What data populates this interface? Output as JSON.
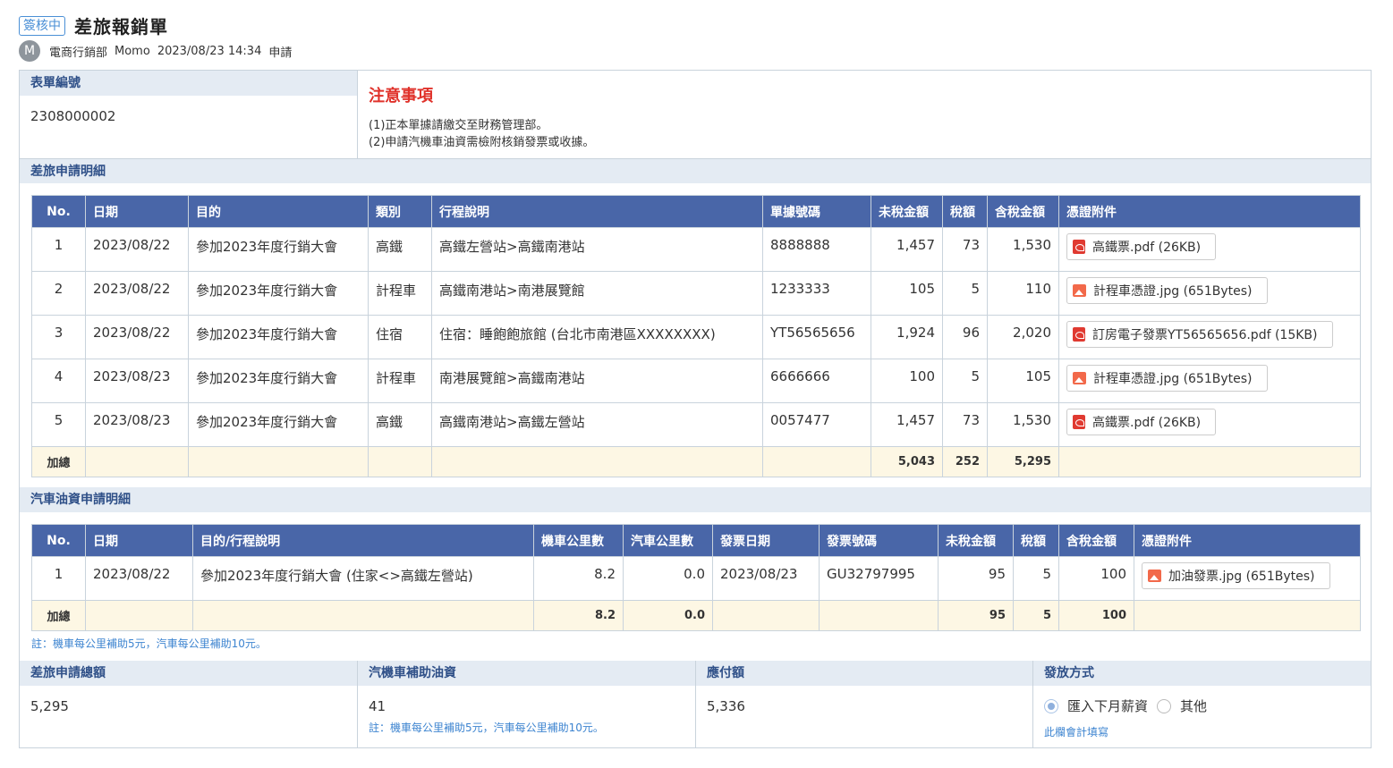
{
  "header": {
    "status_badge": "簽核中",
    "title": "差旅報銷單",
    "avatar_letter": "M",
    "department": "電商行銷部",
    "user": "Momo",
    "datetime": "2023/08/23 14:34",
    "action": "申請"
  },
  "form_no": {
    "label": "表單編號",
    "value": "2308000002"
  },
  "notice": {
    "title": "注意事項",
    "lines": [
      "(1)正本單據請繳交至財務管理部。",
      "(2)申請汽機車油資需檢附核銷發票或收據。"
    ]
  },
  "travel": {
    "section_label": "差旅申請明細",
    "headers": [
      "No.",
      "日期",
      "目的",
      "類別",
      "行程說明",
      "單據號碼",
      "未稅金額",
      "稅額",
      "含稅金額",
      "憑證附件"
    ],
    "rows": [
      [
        "1",
        "2023/08/22",
        "參加2023年度行銷大會",
        "高鐵",
        "高鐵左營站>高鐵南港站",
        "8888888",
        "1,457",
        "73",
        "1,530",
        "高鐵票.pdf (26KB)"
      ],
      [
        "2",
        "2023/08/22",
        "參加2023年度行銷大會",
        "計程車",
        "高鐵南港站>南港展覽館",
        "1233333",
        "105",
        "5",
        "110",
        "計程車憑證.jpg (651Bytes)"
      ],
      [
        "3",
        "2023/08/22",
        "參加2023年度行銷大會",
        "住宿",
        "住宿：睡飽飽旅館 (台北市南港區XXXXXXXX)",
        "YT56565656",
        "1,924",
        "96",
        "2,020",
        "訂房電子發票YT56565656.pdf (15KB)"
      ],
      [
        "4",
        "2023/08/23",
        "參加2023年度行銷大會",
        "計程車",
        "南港展覽館>高鐵南港站",
        "6666666",
        "100",
        "5",
        "105",
        "計程車憑證.jpg (651Bytes)"
      ],
      [
        "5",
        "2023/08/23",
        "參加2023年度行銷大會",
        "高鐵",
        "高鐵南港站>高鐵左營站",
        "0057477",
        "1,457",
        "73",
        "1,530",
        "高鐵票.pdf (26KB)"
      ]
    ],
    "attachment_types": [
      "pdf",
      "image",
      "pdf",
      "image",
      "pdf"
    ],
    "total": {
      "label": "加總",
      "pretax": "5,043",
      "tax": "252",
      "total": "5,295"
    }
  },
  "fuel": {
    "section_label": "汽車油資申請明細",
    "headers": [
      "No.",
      "日期",
      "目的/行程說明",
      "機車公里數",
      "汽車公里數",
      "發票日期",
      "發票號碼",
      "未稅金額",
      "稅額",
      "含稅金額",
      "憑證附件"
    ],
    "rows": [
      [
        "1",
        "2023/08/22",
        "參加2023年度行銷大會 (住家<>高鐵左營站)",
        "8.2",
        "0.0",
        "2023/08/23",
        "GU32797995",
        "95",
        "5",
        "100",
        "加油發票.jpg (651Bytes)"
      ]
    ],
    "total": {
      "label": "加總",
      "moto_km": "8.2",
      "car_km": "0.0",
      "pretax": "95",
      "tax": "5",
      "total": "100"
    },
    "note": "註：機車每公里補助5元，汽車每公里補助10元。"
  },
  "summary": {
    "travel_total": {
      "label": "差旅申請總額",
      "value": "5,295"
    },
    "fuel_subsidy": {
      "label": "汽機車補助油資",
      "value": "41",
      "note": "註：機車每公里補助5元，汽車每公里補助10元。"
    },
    "payable": {
      "label": "應付額",
      "value": "5,336"
    },
    "payment": {
      "label": "發放方式",
      "option1": "匯入下月薪資",
      "option2": "其他",
      "selected": "匯入下月薪資",
      "note": "此欄會計填寫"
    }
  },
  "colors": {
    "header_bg": "#4966a8",
    "section_bg": "#e4ebf3",
    "total_bg": "#fdf7e4",
    "notice_red": "#e0322b",
    "link_blue": "#3d84d0"
  }
}
